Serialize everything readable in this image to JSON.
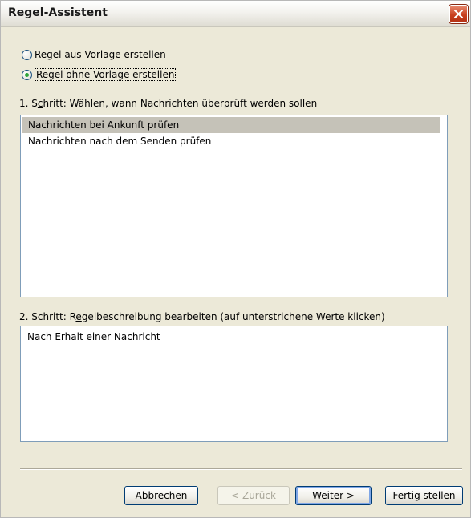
{
  "window": {
    "title": "Regel-Assistent"
  },
  "options": [
    {
      "pre": "Regel aus ",
      "key": "V",
      "post": "orlage erstellen",
      "checked": false
    },
    {
      "pre": "Regel ohne ",
      "key": "V",
      "post": "orlage erstellen",
      "checked": true
    }
  ],
  "step1": {
    "pre": "1. S",
    "key": "c",
    "post": "hritt: Wählen, wann Nachrichten überprüft werden sollen",
    "items": [
      "Nachrichten bei Ankunft prüfen",
      "Nachrichten nach dem Senden prüfen"
    ],
    "selected_index": 0
  },
  "step2": {
    "pre": "2. Schritt: R",
    "key": "e",
    "post": "gelbeschreibung bearbeiten (auf unterstrichene Werte klicken)",
    "description": "Nach Erhalt einer Nachricht"
  },
  "buttons": {
    "cancel": "Abbrechen",
    "back_pre": "< ",
    "back_key": "Z",
    "back_post": "urück",
    "next_key": "W",
    "next_post": "eiter >",
    "finish": "Fertig stellen"
  }
}
